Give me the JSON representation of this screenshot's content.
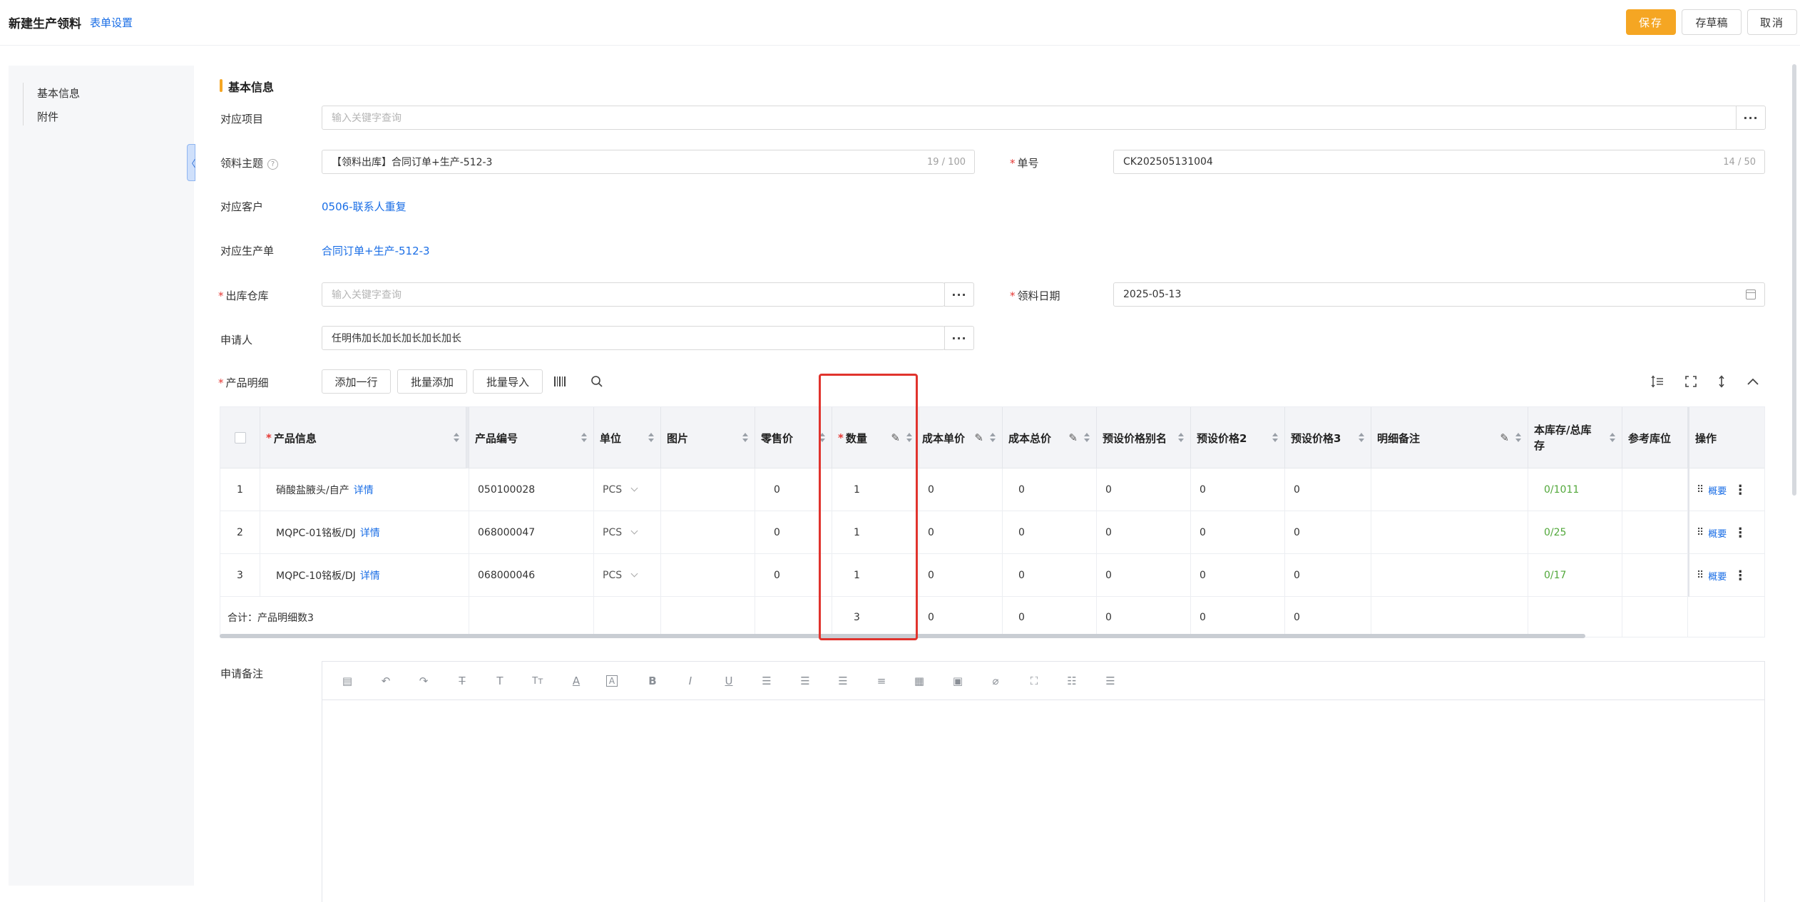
{
  "header": {
    "title": "新建生产领料",
    "form_setting": "表单设置",
    "save": "保存",
    "draft": "存草稿",
    "cancel": "取消"
  },
  "sidebar": {
    "items": [
      {
        "label": "基本信息"
      },
      {
        "label": "附件"
      }
    ],
    "collapse": "〈"
  },
  "section": {
    "title": "基本信息"
  },
  "form": {
    "project": {
      "label": "对应项目",
      "placeholder": "输入关键字查询"
    },
    "subject": {
      "label": "领料主题",
      "value": "【领料出库】合同订单+生产-512-3",
      "count": "19 / 100"
    },
    "order_no": {
      "label": "单号",
      "value": "CK202505131004",
      "count": "14 / 50"
    },
    "customer": {
      "label": "对应客户",
      "value": "0506-联系人重复"
    },
    "production_order": {
      "label": "对应生产单",
      "value": "合同订单+生产-512-3"
    },
    "warehouse": {
      "label": "出库仓库",
      "placeholder": "输入关键字查询"
    },
    "date": {
      "label": "领料日期",
      "value": "2025-05-13"
    },
    "applicant": {
      "label": "申请人",
      "value": "任明伟加长加长加长加长加长"
    },
    "dots": "···"
  },
  "products": {
    "label": "产品明细",
    "add_row": "添加一行",
    "batch_add": "批量添加",
    "batch_import": "批量导入",
    "columns": [
      "产品信息",
      "产品编号",
      "单位",
      "图片",
      "零售价",
      "数量",
      "成本单价",
      "成本总价",
      "预设价格别名",
      "预设价格2",
      "预设价格3",
      "明细备注",
      "本库存/总库存",
      "参考库位",
      "操作"
    ],
    "rows": [
      {
        "idx": "1",
        "name": "硝酸盐腋头/自产",
        "detail": "详情",
        "code": "050100028",
        "unit": "PCS",
        "retail": "0",
        "qty": "1",
        "cost": "0",
        "cost_total": "0",
        "p1": "0",
        "p2": "0",
        "p3": "0",
        "stock": "0",
        "stock_total": "1011",
        "op": "概要"
      },
      {
        "idx": "2",
        "name": "MQPC-01铭板/DJ",
        "detail": "详情",
        "code": "068000047",
        "unit": "PCS",
        "retail": "0",
        "qty": "1",
        "cost": "0",
        "cost_total": "0",
        "p1": "0",
        "p2": "0",
        "p3": "0",
        "stock": "0",
        "stock_total": "25",
        "op": "概要"
      },
      {
        "idx": "3",
        "name": "MQPC-10铭板/DJ",
        "detail": "详情",
        "code": "068000046",
        "unit": "PCS",
        "retail": "0",
        "qty": "1",
        "cost": "0",
        "cost_total": "0",
        "p1": "0",
        "p2": "0",
        "p3": "0",
        "stock": "0",
        "stock_total": "17",
        "op": "概要"
      }
    ],
    "summary": {
      "label": "合计：产品明细数3",
      "qty": "3",
      "cost": "0",
      "cost_total": "0",
      "p1": "0",
      "p2": "0",
      "p3": "0"
    }
  },
  "remark": {
    "label": "申请备注"
  },
  "colors": {
    "accent": "#f5a623",
    "link": "#1a6ee6",
    "highlight": "#e0332d",
    "stock_green": "#52a83b"
  }
}
